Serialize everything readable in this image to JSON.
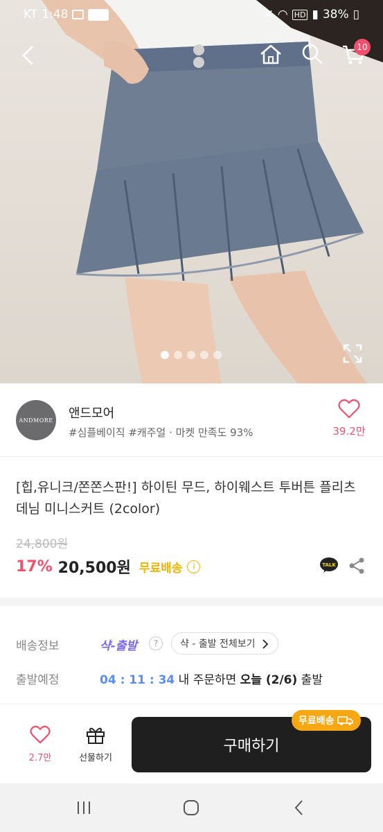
{
  "status_bar": {
    "carrier": "KT",
    "time": "1:48",
    "battery": "38%"
  },
  "nav": {
    "cart_count": "10"
  },
  "gallery": {
    "total_images": 5,
    "current_index": 1
  },
  "store": {
    "logo_text": "ANDMORE",
    "name": "앤드모어",
    "tags": "#심플베이직 #캐주얼 · 마켓 만족도 93%",
    "like_count": "39.2만"
  },
  "product": {
    "title": "[힙,유니크/쫀쫀스판!] 하이틴 무드, 하이웨스트 투버튼 플리츠 데님 미니스커트 (2color)",
    "original_price": "24,800원",
    "discount": "17%",
    "price": "20,500원",
    "free_shipping": "무료배송"
  },
  "delivery": {
    "label_shipping": "배송정보",
    "ship_brand": "샥-출발",
    "ship_pill": "샥 - 출발 전체보기",
    "label_departure": "출발예정",
    "countdown": "04 : 11 : 34",
    "countdown_suffix_a": " 내 주문하면 ",
    "countdown_suffix_b": "오늘 (2/6)",
    "countdown_suffix_c": " 출발"
  },
  "bottom": {
    "wish_count": "2.7만",
    "gift_label": "선물하기",
    "buy_label": "구매하기",
    "free_tag": "무료배송"
  },
  "colors": {
    "accent_pink": "#f0506e",
    "accent_yellow": "#f0b400",
    "accent_blue": "#5b8def",
    "brand_purple": "#7b68ee"
  }
}
